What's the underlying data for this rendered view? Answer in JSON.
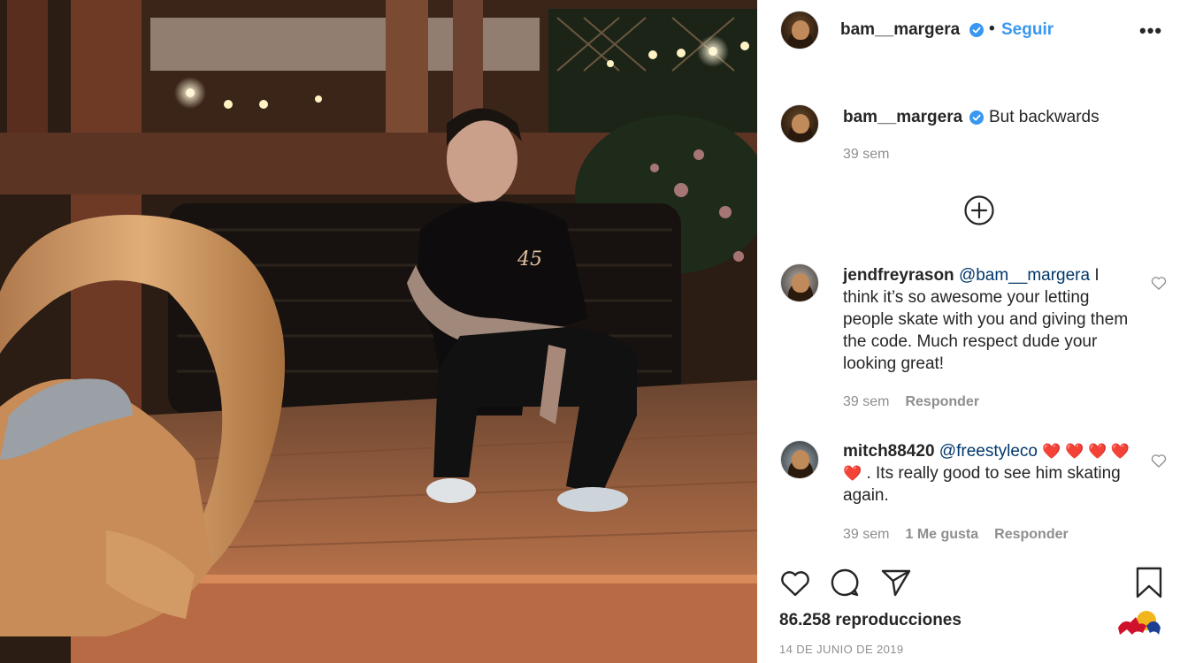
{
  "post": {
    "author": "bam__margera",
    "follow_label": "Seguir",
    "more_label": "•••",
    "dot": "•"
  },
  "caption": {
    "username": "bam__margera",
    "text": "But backwards",
    "time": "39 sem"
  },
  "comments": [
    {
      "username": "jendfreyrason",
      "mention": "@bam__margera",
      "text": " I think it’s so awesome your letting people skate with you and giving them the code. Much respect dude your looking great!",
      "time": "39 sem",
      "reply_label": "Responder"
    },
    {
      "username": "mitch88420",
      "mention": "@freestyleco",
      "hearts": "❤️ ❤️ ❤️ ❤️ ❤️",
      "text": ". Its really good to see him skating again.",
      "time": "39 sem",
      "likes_label": "1 Me gusta",
      "reply_label": "Responder"
    }
  ],
  "stats": {
    "views": "86.258 reproducciones",
    "date": "14 DE JUNIO DE 2019"
  },
  "colors": {
    "link": "#3897f0",
    "verified": "#3897f0",
    "muted": "#8e8e8e",
    "text": "#262626"
  },
  "icons": {
    "load_more": "plus-circle-icon",
    "like": "heart-icon",
    "comment": "comment-bubble-icon",
    "share": "paper-plane-icon",
    "save": "bookmark-icon"
  }
}
